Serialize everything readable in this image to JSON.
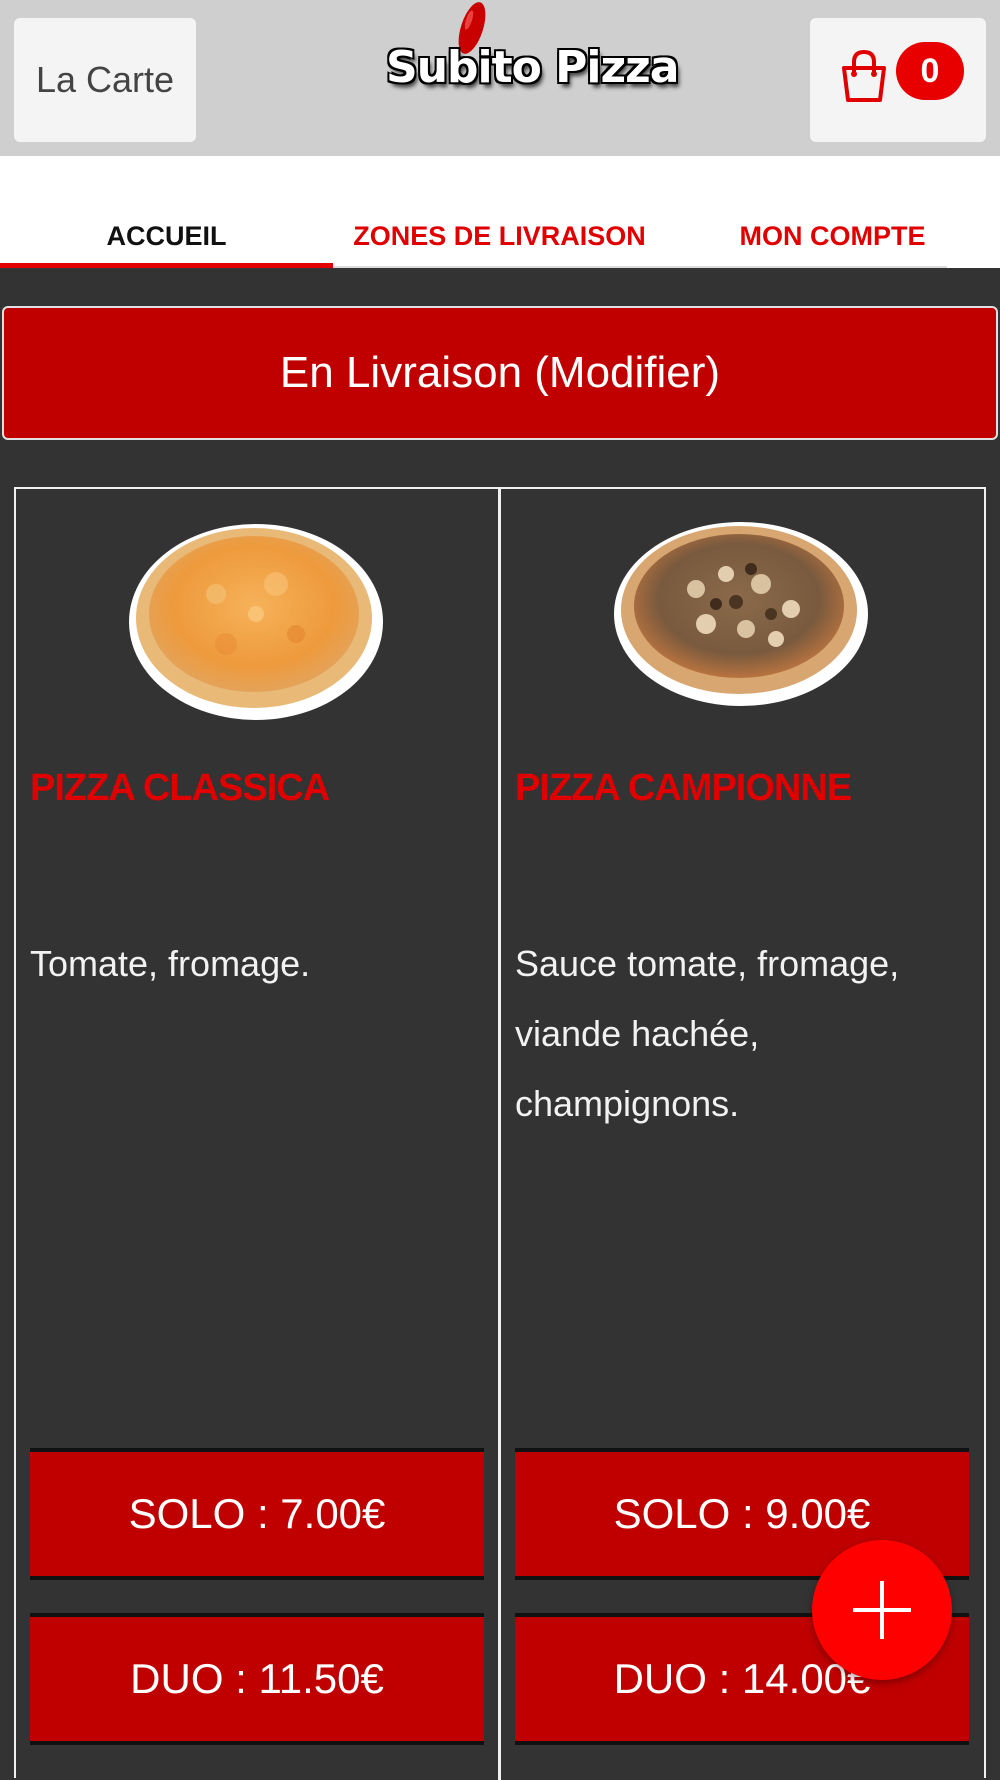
{
  "header": {
    "menu_label": "La Carte",
    "logo_text": "Subito Pizza",
    "cart_count": "0"
  },
  "tabs": [
    {
      "label": "ACCUEIL",
      "active": true
    },
    {
      "label": "ZONES DE LIVRAISON",
      "active": false
    },
    {
      "label": "MON COMPTE",
      "active": false
    }
  ],
  "delivery": {
    "label": "En Livraison (Modifier)"
  },
  "products": [
    {
      "name": "PIZZA CLASSICA",
      "description": "Tomate, fromage.",
      "solo": "SOLO : 7.00€",
      "duo": "DUO : 11.50€"
    },
    {
      "name": "PIZZA CAMPIONNE",
      "description": "Sauce tomate, fromage, viande hachée, champignons.",
      "solo": "SOLO : 9.00€",
      "duo": "DUO : 14.00€"
    }
  ],
  "colors": {
    "brand_red": "#c00000",
    "accent_red": "#e00000",
    "background": "#333333",
    "header": "#cfcfcf"
  },
  "icons": {
    "cart": "shopping-bag-icon",
    "fab": "plus-icon"
  }
}
